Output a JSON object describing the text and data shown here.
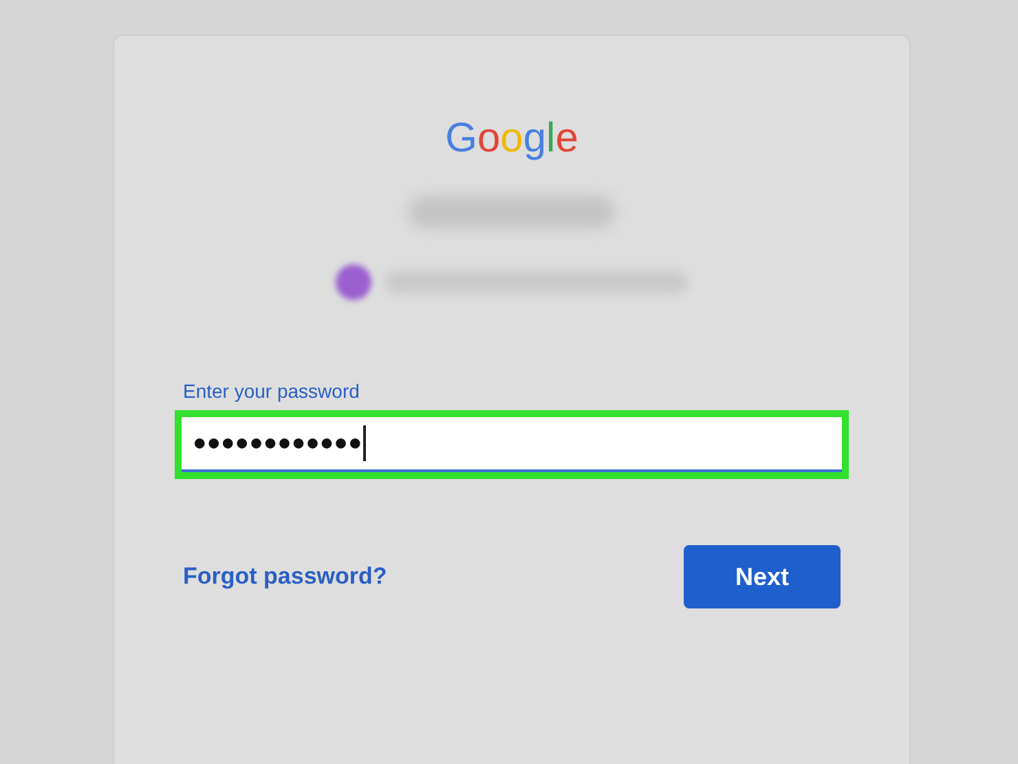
{
  "logo": [
    {
      "char": "G",
      "color": "#4a7fe0"
    },
    {
      "char": "o",
      "color": "#e0463a"
    },
    {
      "char": "o",
      "color": "#f2b705"
    },
    {
      "char": "g",
      "color": "#4a7fe0"
    },
    {
      "char": "l",
      "color": "#3aa757"
    },
    {
      "char": "e",
      "color": "#e0463a"
    }
  ],
  "password_field": {
    "label": "Enter your password",
    "value": "●●●●●●●●●●●●",
    "highlighted": true
  },
  "forgot_link": "Forgot password?",
  "next_button": "Next"
}
